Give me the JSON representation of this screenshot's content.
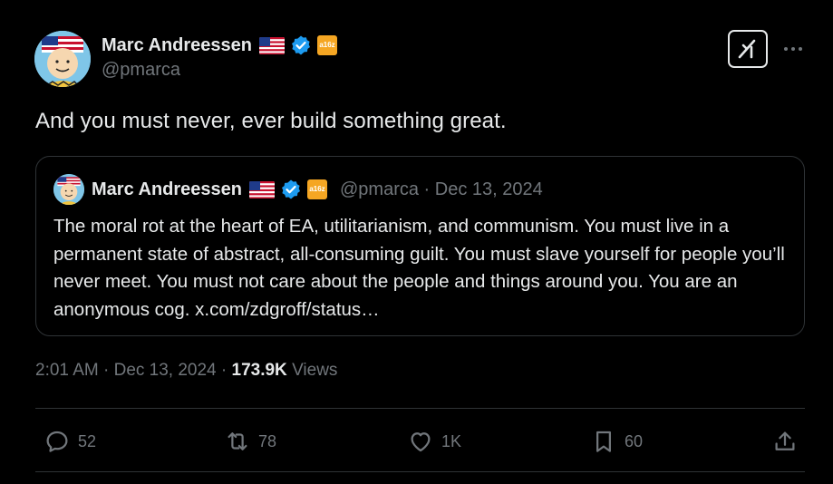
{
  "author": {
    "name": "Marc Andreessen",
    "handle": "@pmarca",
    "affiliation_badge": "a16z"
  },
  "icons": {
    "verified": "verified-badge-icon",
    "flag": "us-flag-icon",
    "grok": "grok-icon",
    "more": "more-icon"
  },
  "tweet": {
    "text": "And you must never, ever build something great."
  },
  "quote": {
    "name": "Marc Andreessen",
    "affiliation_badge": "a16z",
    "meta": "@pmarca · Dec 13, 2024",
    "text": "The moral rot at the heart of EA, utilitarianism, and communism. You must live in a permanent state of abstract, all-consuming guilt. You must slave yourself for people you’ll never meet. You must not care about the people and things around you. You are an anonymous cog. x.com/zdgroff/status…"
  },
  "meta": {
    "time_date": "2:01 AM · Dec 13, 2024 · ",
    "views_count": "173.9K",
    "views_label": " Views"
  },
  "actions": {
    "replies": "52",
    "reposts": "78",
    "likes": "1K",
    "bookmarks": "60"
  },
  "colors": {
    "background": "#000000",
    "text": "#e7e9ea",
    "muted": "#71767b",
    "border": "#2f3336",
    "verified": "#1d9bf0",
    "a16z": "#f5a623"
  }
}
